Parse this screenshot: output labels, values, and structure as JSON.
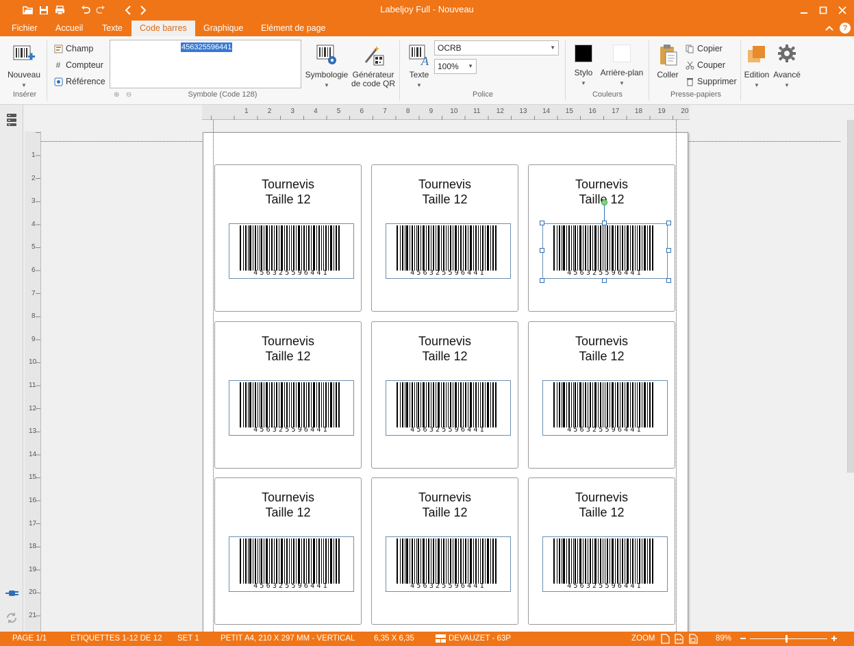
{
  "window": {
    "title": "Labeljoy Full - Nouveau"
  },
  "menu": {
    "tabs": [
      "Fichier",
      "Accueil",
      "Texte",
      "Code barres",
      "Graphique",
      "Elément de page"
    ],
    "active_tab": "Code barres"
  },
  "ribbon": {
    "inserer": {
      "nouveau": "Nouveau",
      "group_label": "Insérer"
    },
    "symbole": {
      "champ": "Champ",
      "compteur": "Compteur",
      "reference": "Référence",
      "value": "456325596441",
      "group_label": "Symbole (Code 128)"
    },
    "symbologie": "Symbologie",
    "generateur_line1": "Générateur",
    "generateur_line2": "de code QR",
    "police": {
      "texte": "Texte",
      "font": "OCRB",
      "zoom": "100%",
      "group_label": "Police"
    },
    "couleurs": {
      "stylo": "Stylo",
      "arriere_plan": "Arrière-plan",
      "group_label": "Couleurs",
      "stylo_color": "#000000",
      "arriere_plan_color": "#ffffff"
    },
    "presse_papiers": {
      "coller": "Coller",
      "copier": "Copier",
      "couper": "Couper",
      "supprimer": "Supprimer",
      "group_label": "Presse-papiers"
    },
    "edition": "Edition",
    "avance": "Avancé"
  },
  "rulers": {
    "horizontal": [
      "1",
      "2",
      "3",
      "4",
      "5",
      "6",
      "7",
      "8",
      "9",
      "10",
      "11",
      "12",
      "13",
      "14",
      "15",
      "16",
      "17",
      "18",
      "19",
      "20"
    ],
    "vertical": [
      "1",
      "2",
      "3",
      "4",
      "5",
      "6",
      "7",
      "8",
      "9",
      "10",
      "11",
      "12",
      "13",
      "14",
      "15",
      "16",
      "17",
      "18",
      "19",
      "20",
      "21"
    ]
  },
  "labels": [
    {
      "line1": "Tournevis",
      "line2": "Taille 12",
      "barcode": "456325596441"
    },
    {
      "line1": "Tournevis",
      "line2": "Taille 12",
      "barcode": "456325596441"
    },
    {
      "line1": "Tournevis",
      "line2": "Taille 12",
      "barcode": "456325596441",
      "selected": true
    },
    {
      "line1": "Tournevis",
      "line2": "Taille 12",
      "barcode": "456325596441"
    },
    {
      "line1": "Tournevis",
      "line2": "Taille 12",
      "barcode": "456325596441"
    },
    {
      "line1": "Tournevis",
      "line2": "Taille 12",
      "barcode": "456325596441"
    },
    {
      "line1": "Tournevis",
      "line2": "Taille 12",
      "barcode": "456325596441"
    },
    {
      "line1": "Tournevis",
      "line2": "Taille 12",
      "barcode": "456325596441"
    },
    {
      "line1": "Tournevis",
      "line2": "Taille 12",
      "barcode": "456325596441"
    }
  ],
  "status": {
    "page": "PAGE 1/1",
    "etiquettes": "ETIQUETTES 1-12 DE 12",
    "set": "SET 1",
    "format": "PETIT A4, 210 X 297 MM - VERTICAL",
    "size": "6,35 X 6,35",
    "template": "DEVAUZET - 63P",
    "zoom_label": "ZOOM",
    "zoom_value": "89%"
  },
  "colors": {
    "accent": "#f07516",
    "selection": "#3779d3"
  }
}
